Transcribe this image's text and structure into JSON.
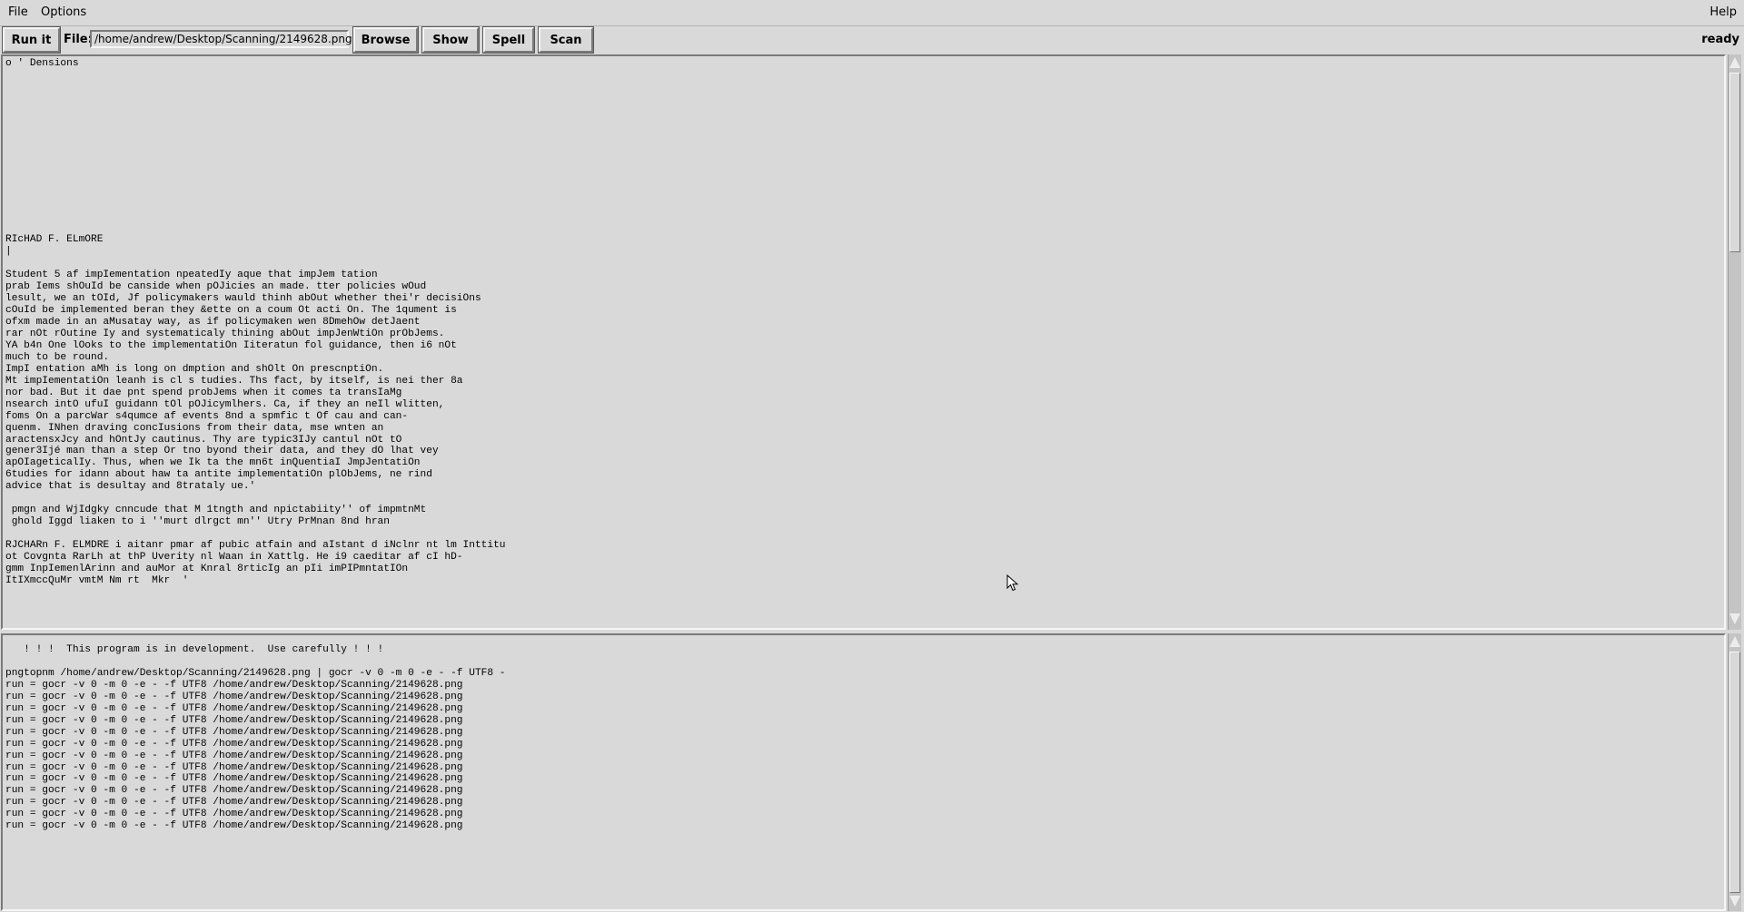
{
  "menubar": {
    "file": "File",
    "options": "Options",
    "help": "Help"
  },
  "toolbar": {
    "run_label": "Run it",
    "file_label": "File:",
    "file_path": "/home/andrew/Desktop/Scanning/2149628.png",
    "browse_label": "Browse",
    "show_label": "Show",
    "spell_label": "Spell",
    "scan_label": "Scan",
    "status": "ready"
  },
  "ocr_text": "o ' Densions\n\n\n\n\n\n\n\n\n\n\n\n\n\n\nRIcHAD F. ELmORE\n|\n\nStudent 5 af impIementation npeatedIy aque that impJem tation\nprab Iems shOuId be canside when pOJicies an made. tter policies wOud\nlesult, we an tOId, Jf policymakers wauld thinh abOut whether thei'r decisiOns\ncOuId be implemented beran they &ette on a coum Ot acti On. The 1qument is\nofxm made in an aMusatay way, as if policymaken wen 8DmehOw detJaent\nrar nOt rOutine Iy and systematicaly thining abOut impJenWtiOn prObJems.\nYA b4n One lOoks to the implementatiOn Iiteratun fol guidance, then i6 nOt\nmuch to be round.\nImpI entation aMh is long on dmption and shOlt On prescnptiOn.\nMt impIementatiOn leanh is cl s tudies. Ths fact, by itself, is nei ther 8a\nnor bad. But it dae pnt spend probJems when it comes ta transIaMg\nnsearch intO ufuI guidann tOl pOJicymlhers. Ca, if they an neIl wlitten,\nfoms On a parcWar s4qumce af events 8nd a spmfic t Of cau and can-\nquenm. INhen draving concIusions from their data, mse wnten an\naractensxJcy and hOntJy cautinus. Thy are typic3IJy cantul nOt tO\ngener3Ijé man than a step Or tno byond their data, and they dO lhat vey\napOIageticalIy. Thus, when we Ik ta the mn6t inQuentiaI JmpJentatiOn\n6tudies for idann about haw ta antite implementatiOn plObJems, ne rind\nadvice that is desultay and 8trataly ue.'\n\n pmgn and WjIdgky cnncude that M 1tngth and npictabiity'' of impmtnMt\n ghold Iggd liaken to i ''murt dlrgct mn'' Utry PrMnan 8nd hran\n\nRJCHARn F. ELMDRE i aitanr pmar af pubic atfain and aIstant d iNclnr nt lm Inttitu\not Covgnta RarLh at thP Uverity nl Waan in Xattlg. He i9 caeditar af cI hD-\ngmm InpIemenlArinn and auMor at Knral 8rticIg an pIi imPIPmntatIOn\nItIXmccQuMr vmtM Nm rt  Mkr  '",
  "log_text": "   ! ! !  This program is in development.  Use carefully ! ! !\n\npngtopnm /home/andrew/Desktop/Scanning/2149628.png | gocr -v 0 -m 0 -e - -f UTF8 -\nrun = gocr -v 0 -m 0 -e - -f UTF8 /home/andrew/Desktop/Scanning/2149628.png\nrun = gocr -v 0 -m 0 -e - -f UTF8 /home/andrew/Desktop/Scanning/2149628.png\nrun = gocr -v 0 -m 0 -e - -f UTF8 /home/andrew/Desktop/Scanning/2149628.png\nrun = gocr -v 0 -m 0 -e - -f UTF8 /home/andrew/Desktop/Scanning/2149628.png\nrun = gocr -v 0 -m 0 -e - -f UTF8 /home/andrew/Desktop/Scanning/2149628.png\nrun = gocr -v 0 -m 0 -e - -f UTF8 /home/andrew/Desktop/Scanning/2149628.png\nrun = gocr -v 0 -m 0 -e - -f UTF8 /home/andrew/Desktop/Scanning/2149628.png\nrun = gocr -v 0 -m 0 -e - -f UTF8 /home/andrew/Desktop/Scanning/2149628.png\nrun = gocr -v 0 -m 0 -e - -f UTF8 /home/andrew/Desktop/Scanning/2149628.png\nrun = gocr -v 0 -m 0 -e - -f UTF8 /home/andrew/Desktop/Scanning/2149628.png\nrun = gocr -v 0 -m 0 -e - -f UTF8 /home/andrew/Desktop/Scanning/2149628.png\nrun = gocr -v 0 -m 0 -e - -f UTF8 /home/andrew/Desktop/Scanning/2149628.png\nrun = gocr -v 0 -m 0 -e - -f UTF8 /home/andrew/Desktop/Scanning/2149628.png",
  "icons": {
    "scroll_up": "arrow-up-icon",
    "scroll_down": "arrow-down-icon",
    "mouse": "mouse-pointer-icon"
  }
}
